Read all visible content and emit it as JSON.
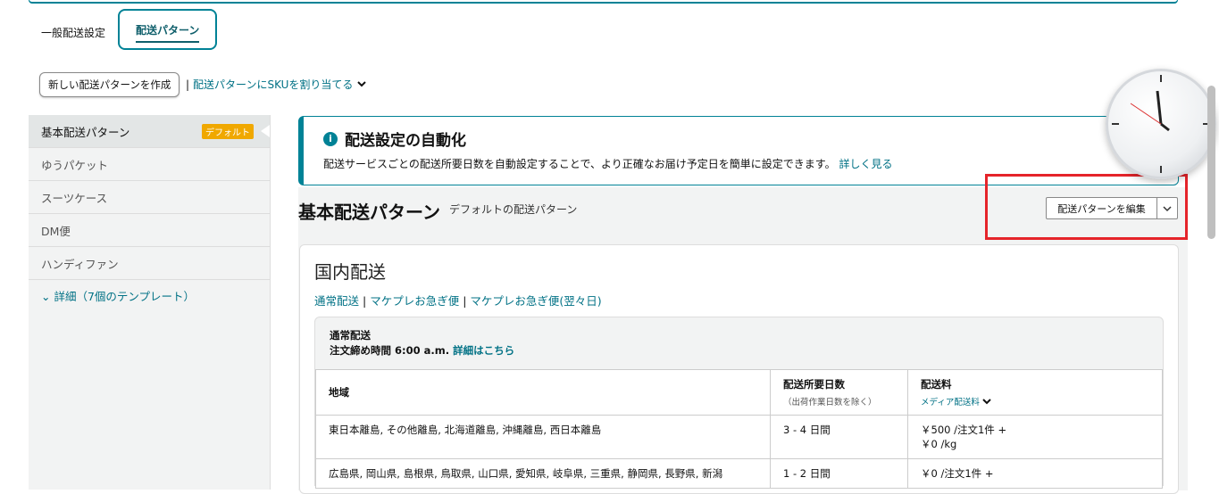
{
  "tabs": [
    {
      "label": "一般配送設定",
      "active": false
    },
    {
      "label": "配送パターン",
      "active": true
    }
  ],
  "actions": {
    "new_pattern_button": "新しい配送パターンを作成",
    "separator": "|",
    "assign_sku_link": "配送パターンにSKUを割り当てる"
  },
  "sidebar": {
    "items": [
      {
        "label": "基本配送パターン",
        "badge": "デフォルト",
        "selected": true
      },
      {
        "label": "ゆうパケット"
      },
      {
        "label": "スーツケース"
      },
      {
        "label": "DM便"
      },
      {
        "label": "ハンディファン"
      }
    ],
    "more_label": "詳細（7個のテンプレート）"
  },
  "info": {
    "title": "配送設定の自動化",
    "text": "配送サービスごとの配送所要日数を自動設定することで、より正確なお届け予定日を簡単に設定できます。",
    "link": "詳しく見る"
  },
  "pattern": {
    "title": "基本配送パターン",
    "subtitle": "デフォルトの配送パターン",
    "edit_button": "配送パターンを編集"
  },
  "domestic": {
    "title": "国内配送",
    "links": [
      "通常配送",
      "マケプレお急ぎ便",
      "マケプレお急ぎ便(翌々日)"
    ],
    "shipping_title": "通常配送",
    "cutoff_text": "注文締め時間 6:00 a.m.",
    "details_link": "詳細はこちら",
    "table": {
      "headers": {
        "region": "地域",
        "transit": "配送所要日数",
        "transit_note": "（出荷作業日数を除く）",
        "fee": "配送料",
        "fee_option": "メディア配送料"
      },
      "rows": [
        {
          "region": "東日本離島, その他離島, 北海道離島, 沖縄離島, 西日本離島",
          "days": "3 - 4 日間",
          "fee1": "￥500 /注文1件 +",
          "fee2": "￥0 /kg"
        },
        {
          "region": "広島県, 岡山県, 島根県, 鳥取県, 山口県, 愛知県, 岐阜県, 三重県, 静岡県, 長野県, 新潟",
          "days": "1 - 2 日間",
          "fee1": "￥0 /注文1件 +",
          "fee2": ""
        }
      ]
    }
  },
  "colors": {
    "accent": "#008296",
    "link": "#007185",
    "badge": "#f0a800",
    "highlight": "#e5242a"
  }
}
